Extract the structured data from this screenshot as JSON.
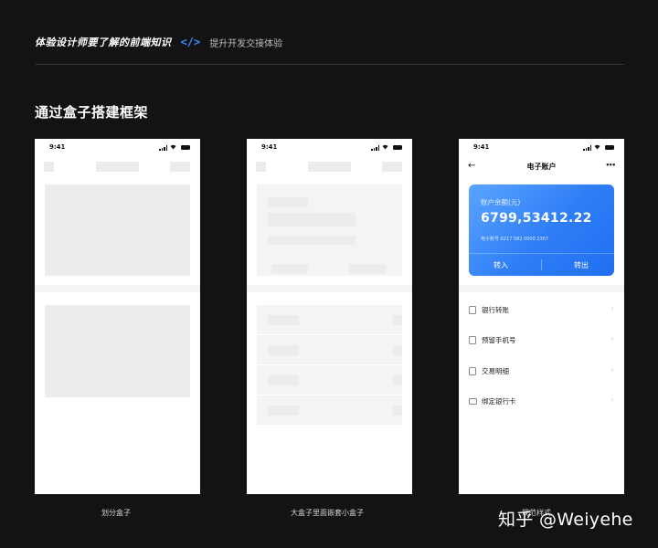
{
  "header": {
    "title": "体验设计师要了解的前端知识",
    "code_icon": "</>",
    "subtitle": "提升开发交接体验"
  },
  "section_title": "通过盒子搭建框架",
  "phones": [
    {
      "time": "9:41",
      "caption": "划分盒子"
    },
    {
      "time": "9:41",
      "caption": "大盒子里面嵌套小盒子"
    },
    {
      "time": "9:41",
      "caption": "规范样式",
      "nav_title": "电子账户",
      "back_icon": "←",
      "more_icon": "•••",
      "card": {
        "label": "账户余额(元)",
        "amount": "6799,53412.22",
        "account": "电子账号 6217 582 0000 2367",
        "transfer_in": "转入",
        "transfer_out": "转出"
      },
      "list": [
        {
          "label": "银行转账",
          "icon": "transfer-icon"
        },
        {
          "label": "预留手机号",
          "icon": "phone-icon"
        },
        {
          "label": "交易明细",
          "icon": "document-icon"
        },
        {
          "label": "绑定银行卡",
          "icon": "card-icon"
        }
      ],
      "arrow": "›"
    }
  ],
  "watermark": "知乎 @Weiyehe",
  "colors": {
    "accent": "#2f7df7",
    "background": "#131313",
    "placeholder": "#ececec"
  }
}
